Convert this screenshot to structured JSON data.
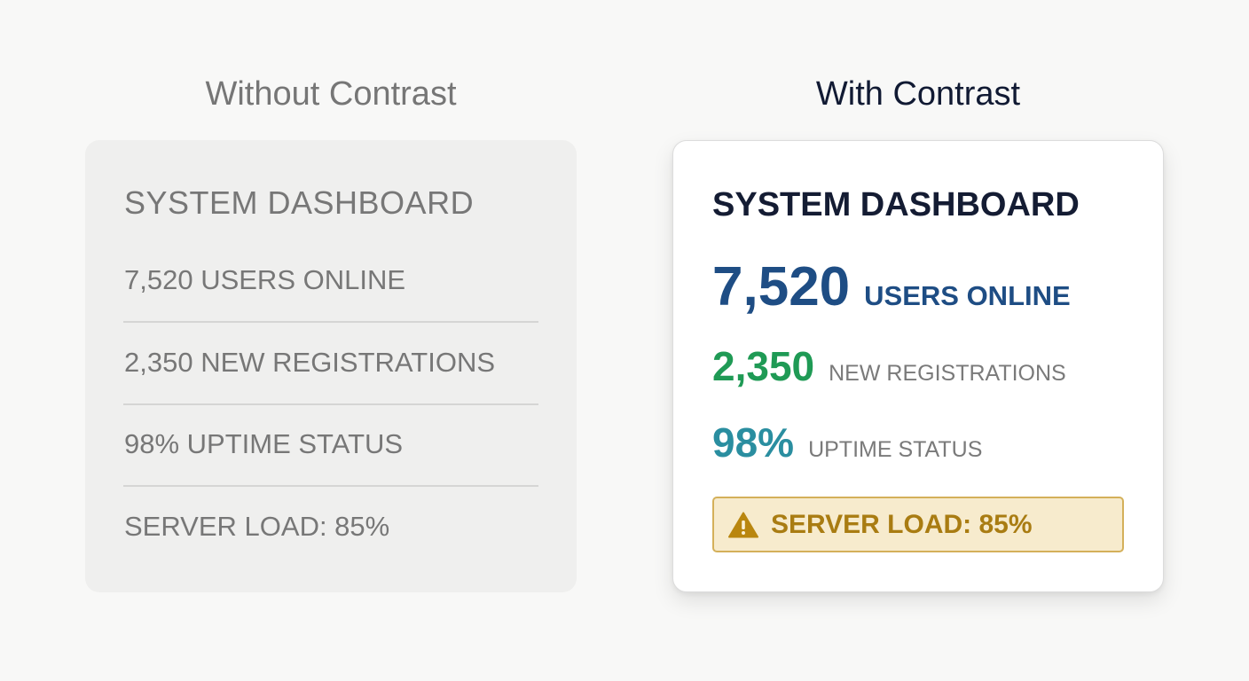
{
  "left_panel": {
    "heading": "Without Contrast",
    "dashboard_title": "SYSTEM DASHBOARD",
    "rows": [
      "7,520 USERS ONLINE",
      "2,350 NEW REGISTRATIONS",
      "98% UPTIME STATUS",
      "SERVER LOAD: 85%"
    ]
  },
  "right_panel": {
    "heading": "With Contrast",
    "dashboard_title": "SYSTEM DASHBOARD",
    "users": {
      "value": "7,520",
      "label": "USERS ONLINE",
      "color": "#1e4d84"
    },
    "registrations": {
      "value": "2,350",
      "label": "NEW REGISTRATIONS",
      "color": "#1f9a55"
    },
    "uptime": {
      "value": "98%",
      "label": "UPTIME STATUS",
      "color": "#2a8ea0"
    },
    "alert": {
      "icon": "warning-icon",
      "text": "SERVER LOAD: 85%",
      "color": "#a97c12",
      "background": "#f7ebcd"
    }
  }
}
